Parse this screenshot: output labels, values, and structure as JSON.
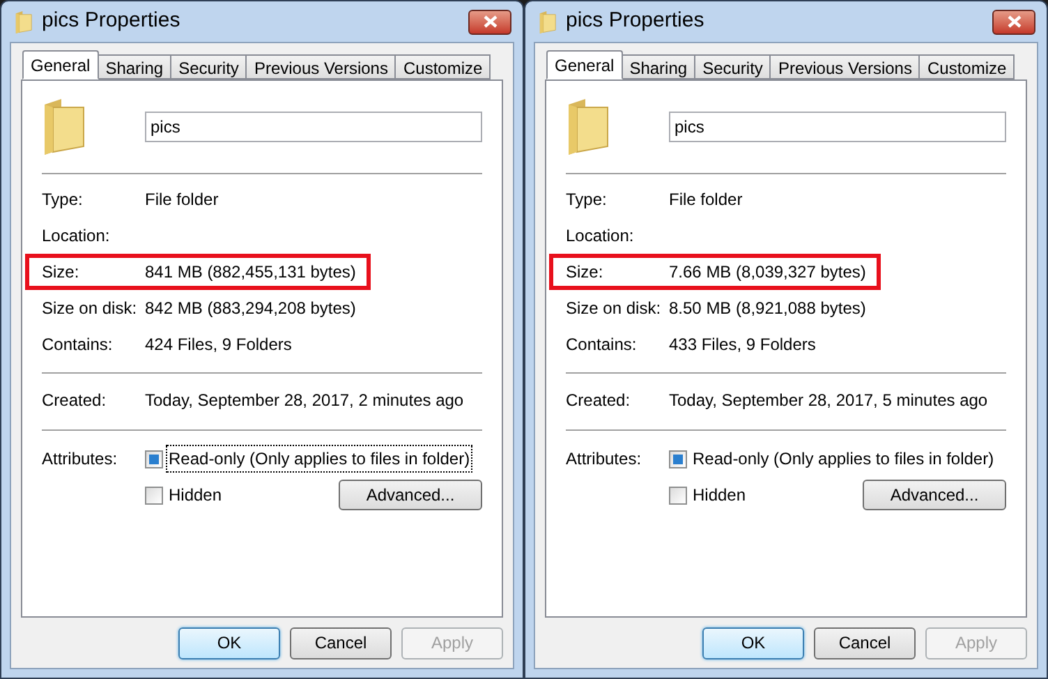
{
  "dialogs": [
    {
      "title": "pics Properties",
      "tabs": [
        {
          "label": "General",
          "selected": true
        },
        {
          "label": "Sharing",
          "selected": false
        },
        {
          "label": "Security",
          "selected": false
        },
        {
          "label": "Previous Versions",
          "selected": false
        },
        {
          "label": "Customize",
          "selected": false
        }
      ],
      "name_field": {
        "value": "pics"
      },
      "facts": [
        {
          "label": "Type:",
          "value": "File folder",
          "highlighted": false
        },
        {
          "label": "Location:",
          "highlighted": false
        },
        {
          "label": "Size:",
          "value": "841 MB (882,455,131 bytes)",
          "highlighted": true
        },
        {
          "label": "Size on disk:",
          "value": "842 MB (883,294,208 bytes)",
          "highlighted": false
        },
        {
          "label": "Contains:",
          "value": "424 Files, 9 Folders",
          "highlighted": false
        }
      ],
      "created": {
        "label": "Created:",
        "value": "Today, September 28, 2017, 2 minutes ago"
      },
      "attributes": {
        "label": "Attributes:",
        "checkboxes": [
          {
            "label": "Read-only (Only applies to files in folder)",
            "indeterminate": true,
            "focused": true
          },
          {
            "label": "Hidden",
            "indeterminate": false,
            "focused": false
          }
        ],
        "advanced": "Advanced..."
      },
      "buttons": [
        {
          "label": "OK",
          "default": true,
          "disabled": false
        },
        {
          "label": "Cancel",
          "default": false,
          "disabled": false
        },
        {
          "label": "Apply",
          "default": false,
          "disabled": true
        }
      ]
    },
    {
      "title": "pics Properties",
      "tabs": [
        {
          "label": "General",
          "selected": true
        },
        {
          "label": "Sharing",
          "selected": false
        },
        {
          "label": "Security",
          "selected": false
        },
        {
          "label": "Previous Versions",
          "selected": false
        },
        {
          "label": "Customize",
          "selected": false
        }
      ],
      "name_field": {
        "value": "pics"
      },
      "facts": [
        {
          "label": "Type:",
          "value": "File folder",
          "highlighted": false
        },
        {
          "label": "Location:",
          "highlighted": false
        },
        {
          "label": "Size:",
          "value": "7.66 MB (8,039,327 bytes)",
          "highlighted": true
        },
        {
          "label": "Size on disk:",
          "value": "8.50 MB (8,921,088 bytes)",
          "highlighted": false
        },
        {
          "label": "Contains:",
          "value": "433 Files, 9 Folders",
          "highlighted": false
        }
      ],
      "created": {
        "label": "Created:",
        "value": "Today, September 28, 2017, 5 minutes ago"
      },
      "attributes": {
        "label": "Attributes:",
        "checkboxes": [
          {
            "label": "Read-only (Only applies to files in folder)",
            "indeterminate": true,
            "focused": false
          },
          {
            "label": "Hidden",
            "indeterminate": false,
            "focused": false
          }
        ],
        "advanced": "Advanced..."
      },
      "buttons": [
        {
          "label": "OK",
          "default": true,
          "disabled": false
        },
        {
          "label": "Cancel",
          "default": false,
          "disabled": false
        },
        {
          "label": "Apply",
          "default": false,
          "disabled": true
        }
      ]
    }
  ]
}
